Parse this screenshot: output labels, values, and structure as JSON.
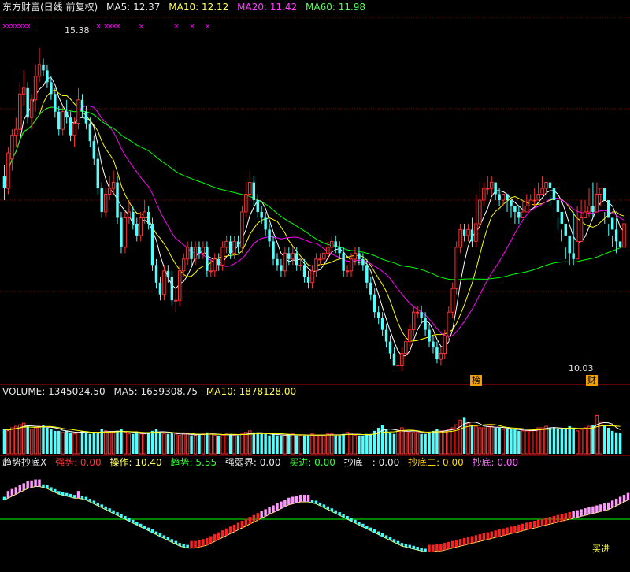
{
  "header": {
    "title": "东方财富(日线 前复权)",
    "ma5": "MA5: 12.37",
    "ma10": "MA10: 12.12",
    "ma20": "MA20: 11.42",
    "ma60": "MA60: 11.98"
  },
  "volume_header": {
    "label": "VOLUME: 1345024.50",
    "ma5": "MA5: 1659308.75",
    "ma10": "MA10: 1878128.00"
  },
  "indicator_header": {
    "title": "趋势抄底X",
    "strong": "强势: 0.00",
    "operate": "操作: 10.40",
    "trend": "趋势: 5.55",
    "boundary": "强弱界: 0.00",
    "buy": "买进: 0.00",
    "bottom1": "抄底一: 0.00",
    "bottom2": "抄底二: 0.00",
    "bottom": "抄底: 0.00"
  },
  "annotations": {
    "high": "15.38",
    "low": "10.03",
    "badge_1": "榜",
    "badge_2": "财",
    "buy_tag": "买进"
  },
  "colors": {
    "up": "#ff3232",
    "down": "#54ffff",
    "ma5": "#ffffff",
    "ma10": "#ffff00",
    "ma20": "#ff00ff",
    "ma60": "#00ff00",
    "grid": "#8b0000",
    "indicator_line": "#00ff00"
  },
  "chart_data": [
    {
      "type": "candlestick",
      "panel": "price",
      "ylim": [
        9.7,
        15.9
      ],
      "grid": true,
      "x": [
        1,
        2,
        3,
        4,
        5,
        6,
        7,
        8,
        9,
        10,
        11,
        12,
        13,
        14,
        15,
        16,
        17,
        18,
        19,
        20,
        21,
        22,
        23,
        24,
        25,
        26,
        27,
        28,
        29,
        30,
        31,
        32,
        33,
        34,
        35,
        36,
        37,
        38,
        39,
        40,
        41,
        42,
        43,
        44,
        45,
        46,
        47,
        48,
        49,
        50,
        51,
        52,
        53,
        54,
        55,
        56,
        57,
        58,
        59,
        60,
        61,
        62,
        63,
        64,
        65,
        66,
        67,
        68,
        69,
        70,
        71,
        72,
        73,
        74,
        75,
        76,
        77,
        78,
        79,
        80,
        81,
        82,
        83,
        84,
        85,
        86,
        87,
        88,
        89,
        90,
        91,
        92,
        93,
        94,
        95,
        96,
        97,
        98,
        99,
        100,
        101,
        102,
        103,
        104,
        105,
        106,
        107,
        108,
        109,
        110,
        111,
        112,
        113,
        114,
        115,
        116,
        117,
        118,
        119,
        120,
        121,
        122,
        123,
        124,
        125,
        126,
        127,
        128,
        129,
        130,
        131,
        132,
        133,
        134,
        135,
        136,
        137,
        138,
        139,
        140,
        141,
        142,
        143,
        144,
        145,
        146,
        147,
        148,
        149,
        150,
        151,
        152,
        153,
        154,
        155,
        156,
        157,
        158,
        159,
        160
      ],
      "open": [
        13.2,
        13.0,
        13.5,
        13.9,
        14.0,
        14.6,
        14.7,
        14.2,
        14.5,
        14.9,
        15.1,
        15.0,
        14.8,
        14.6,
        14.3,
        14.0,
        14.3,
        14.2,
        13.9,
        14.1,
        14.5,
        14.3,
        14.1,
        13.8,
        13.5,
        13.0,
        12.6,
        12.9,
        13.0,
        13.1,
        12.5,
        12.0,
        12.5,
        12.6,
        12.4,
        12.2,
        12.5,
        12.6,
        12.4,
        11.7,
        11.4,
        11.2,
        11.6,
        11.5,
        11.1,
        11.1,
        11.6,
        11.8,
        12.0,
        11.8,
        12.0,
        11.9,
        12.0,
        11.6,
        11.6,
        11.8,
        11.7,
        12.0,
        12.1,
        11.9,
        12.1,
        12.0,
        12.6,
        12.9,
        13.1,
        12.8,
        12.6,
        12.5,
        12.3,
        12.1,
        11.8,
        11.7,
        11.6,
        11.9,
        11.8,
        11.9,
        11.7,
        11.7,
        11.5,
        11.4,
        11.6,
        11.8,
        11.8,
        11.9,
        12.0,
        12.1,
        12.0,
        11.9,
        11.6,
        11.6,
        11.8,
        11.9,
        11.8,
        11.7,
        11.4,
        11.2,
        10.9,
        10.8,
        10.6,
        10.4,
        10.2,
        10.0,
        10.0,
        10.2,
        10.4,
        10.6,
        10.9,
        10.9,
        10.8,
        10.6,
        10.4,
        10.3,
        10.1,
        10.2,
        10.5,
        10.9,
        11.3,
        12.0,
        12.3,
        12.2,
        12.3,
        12.1,
        12.4,
        12.8,
        13.0,
        13.0,
        13.1,
        12.9,
        12.8,
        12.9,
        12.8,
        12.7,
        12.6,
        12.5,
        12.6,
        12.7,
        12.8,
        12.8,
        12.9,
        13.0,
        13.1,
        13.0,
        12.8,
        12.6,
        12.4,
        12.2,
        11.9,
        11.8,
        12.1,
        12.5,
        12.6,
        12.7,
        12.6,
        12.9,
        13.0,
        12.8,
        12.5,
        12.3,
        12.1,
        12.0
      ],
      "close": [
        13.0,
        13.6,
        13.9,
        14.0,
        14.6,
        14.7,
        14.2,
        14.5,
        14.9,
        15.1,
        15.0,
        14.8,
        14.6,
        14.3,
        14.0,
        14.3,
        14.2,
        13.9,
        14.1,
        14.5,
        14.3,
        14.1,
        13.8,
        13.5,
        13.0,
        12.6,
        12.9,
        13.0,
        13.1,
        12.5,
        12.0,
        12.5,
        12.6,
        12.4,
        12.2,
        12.5,
        12.6,
        12.4,
        11.7,
        11.4,
        11.2,
        11.6,
        11.5,
        11.1,
        11.1,
        11.6,
        11.8,
        12.0,
        11.8,
        12.0,
        11.9,
        12.0,
        11.6,
        11.6,
        11.8,
        11.7,
        12.0,
        12.1,
        11.9,
        12.1,
        12.0,
        12.6,
        12.9,
        13.1,
        12.8,
        12.6,
        12.5,
        12.3,
        12.1,
        11.8,
        11.7,
        11.6,
        11.9,
        11.8,
        11.9,
        11.7,
        11.7,
        11.5,
        11.4,
        11.6,
        11.8,
        11.8,
        11.9,
        12.0,
        12.1,
        12.0,
        11.9,
        11.6,
        11.6,
        11.8,
        11.9,
        11.8,
        11.7,
        11.4,
        11.2,
        10.9,
        10.8,
        10.6,
        10.4,
        10.2,
        10.0,
        10.0,
        10.2,
        10.4,
        10.6,
        10.9,
        10.9,
        10.8,
        10.6,
        10.4,
        10.3,
        10.1,
        10.2,
        10.5,
        10.9,
        11.3,
        12.0,
        12.3,
        12.2,
        12.3,
        12.1,
        12.4,
        12.8,
        13.0,
        13.0,
        13.1,
        12.9,
        12.8,
        12.9,
        12.8,
        12.7,
        12.6,
        12.5,
        12.6,
        12.7,
        12.8,
        12.8,
        12.9,
        13.0,
        13.1,
        13.0,
        12.8,
        12.6,
        12.4,
        12.2,
        11.9,
        11.8,
        12.1,
        12.5,
        12.6,
        12.7,
        12.6,
        12.9,
        13.0,
        12.8,
        12.5,
        12.3,
        12.1,
        12.0,
        12.4
      ],
      "high": [
        13.4,
        13.7,
        14.0,
        14.2,
        14.8,
        15.0,
        14.8,
        14.6,
        15.1,
        15.38,
        15.2,
        15.1,
        14.9,
        14.7,
        14.4,
        14.4,
        14.5,
        14.3,
        14.2,
        14.7,
        14.6,
        14.4,
        14.2,
        13.9,
        13.6,
        13.1,
        13.0,
        13.2,
        13.3,
        13.2,
        12.6,
        12.6,
        12.8,
        12.7,
        12.5,
        12.6,
        12.8,
        12.7,
        12.5,
        11.8,
        11.5,
        11.7,
        11.7,
        11.6,
        11.3,
        11.7,
        11.9,
        12.1,
        12.1,
        12.1,
        12.1,
        12.1,
        12.1,
        11.8,
        11.9,
        11.9,
        12.1,
        12.2,
        12.2,
        12.2,
        12.2,
        12.7,
        13.1,
        13.3,
        13.2,
        12.9,
        12.7,
        12.6,
        12.4,
        12.2,
        11.9,
        11.8,
        12.0,
        12.0,
        12.0,
        12.0,
        11.8,
        11.8,
        11.6,
        11.7,
        11.9,
        11.9,
        12.0,
        12.1,
        12.2,
        12.2,
        12.1,
        12.0,
        11.7,
        11.9,
        12.0,
        12.0,
        11.9,
        11.8,
        11.5,
        11.3,
        11.0,
        10.9,
        10.7,
        10.5,
        10.3,
        10.1,
        10.3,
        10.5,
        10.7,
        11.0,
        11.0,
        11.0,
        10.9,
        10.7,
        10.5,
        10.4,
        10.3,
        10.6,
        11.0,
        11.4,
        12.1,
        12.4,
        12.4,
        12.4,
        12.5,
        12.9,
        13.1,
        13.1,
        13.2,
        13.2,
        13.0,
        13.0,
        12.9,
        12.8,
        12.7,
        12.6,
        12.7,
        12.8,
        12.9,
        12.9,
        13.0,
        13.1,
        13.2,
        13.1,
        12.9,
        12.7,
        12.5,
        12.3,
        12.0,
        12.2,
        12.6,
        12.7,
        12.8,
        12.8,
        13.0,
        13.1,
        13.1,
        12.9,
        12.6,
        12.4,
        12.2,
        12.5
      ],
      "low": [
        12.8,
        12.9,
        13.3,
        13.7,
        13.9,
        14.4,
        14.1,
        14.0,
        14.3,
        14.8,
        14.9,
        14.7,
        14.5,
        14.2,
        13.9,
        13.9,
        14.1,
        13.8,
        13.7,
        14.0,
        14.2,
        14.0,
        13.7,
        13.4,
        12.9,
        12.5,
        12.5,
        12.8,
        12.9,
        12.4,
        11.9,
        11.9,
        12.4,
        12.3,
        12.1,
        12.1,
        12.4,
        12.3,
        11.6,
        11.3,
        11.1,
        11.1,
        11.4,
        11.0,
        10.9,
        11.0,
        11.5,
        11.7,
        11.7,
        11.7,
        11.8,
        11.8,
        11.5,
        11.5,
        11.5,
        11.6,
        11.6,
        11.9,
        11.8,
        11.8,
        11.9,
        11.9,
        12.5,
        12.8,
        12.7,
        12.5,
        12.4,
        12.2,
        12.0,
        11.7,
        11.6,
        11.5,
        11.5,
        11.7,
        11.7,
        11.6,
        11.6,
        11.4,
        11.3,
        11.3,
        11.5,
        11.7,
        11.7,
        11.8,
        11.9,
        11.9,
        11.8,
        11.5,
        11.5,
        11.5,
        11.7,
        11.7,
        11.6,
        11.3,
        11.1,
        10.8,
        10.7,
        10.5,
        10.3,
        10.1,
        10.03,
        10.03,
        9.9,
        10.1,
        10.3,
        10.5,
        10.8,
        10.7,
        10.5,
        10.3,
        10.2,
        10.03,
        10.0,
        10.1,
        10.4,
        10.8,
        11.2,
        11.9,
        12.1,
        12.1,
        12.0,
        12.0,
        12.3,
        12.7,
        12.9,
        12.9,
        12.8,
        12.7,
        12.7,
        12.6,
        12.5,
        12.4,
        12.4,
        12.5,
        12.6,
        12.7,
        12.7,
        12.8,
        12.9,
        12.9,
        12.7,
        12.5,
        12.3,
        12.1,
        11.8,
        11.7,
        11.7,
        12.0,
        12.4,
        12.5,
        12.5,
        12.5,
        12.8,
        12.7,
        12.4,
        12.2,
        12.0,
        11.9
      ],
      "series": [
        {
          "name": "MA5",
          "value": 12.37
        },
        {
          "name": "MA10",
          "value": 12.12
        },
        {
          "name": "MA20",
          "value": 11.42
        },
        {
          "name": "MA60",
          "value": 11.98
        }
      ]
    },
    {
      "type": "bar",
      "panel": "volume",
      "ylim": [
        0,
        3500000
      ],
      "values": [
        1.6,
        1.5,
        1.7,
        1.8,
        1.9,
        2.0,
        1.8,
        1.6,
        1.7,
        1.8,
        1.9,
        1.7,
        1.6,
        1.5,
        1.5,
        1.4,
        1.5,
        1.4,
        1.3,
        1.4,
        1.5,
        1.4,
        1.3,
        1.4,
        1.4,
        1.6,
        1.5,
        1.4,
        1.4,
        1.5,
        1.6,
        1.4,
        1.3,
        1.3,
        1.4,
        1.3,
        1.3,
        1.4,
        1.5,
        1.6,
        1.4,
        1.3,
        1.3,
        1.4,
        1.3,
        1.2,
        1.3,
        1.3,
        1.2,
        1.2,
        1.3,
        1.3,
        1.4,
        1.3,
        1.2,
        1.2,
        1.2,
        1.3,
        1.3,
        1.2,
        1.2,
        1.3,
        1.4,
        1.5,
        1.4,
        1.3,
        1.3,
        1.3,
        1.2,
        1.3,
        1.2,
        1.2,
        1.2,
        1.3,
        1.3,
        1.2,
        1.2,
        1.2,
        1.2,
        1.3,
        1.2,
        1.2,
        1.2,
        1.3,
        1.3,
        1.2,
        1.2,
        1.3,
        1.4,
        1.3,
        1.2,
        1.2,
        1.2,
        1.3,
        1.3,
        1.5,
        1.7,
        1.9,
        1.6,
        1.4,
        1.3,
        1.5,
        1.7,
        1.5,
        1.4,
        1.4,
        1.4,
        1.3,
        1.3,
        1.4,
        1.5,
        1.6,
        1.5,
        1.5,
        1.6,
        1.7,
        1.9,
        2.2,
        2.4,
        2.0,
        1.9,
        1.8,
        1.7,
        1.7,
        1.8,
        1.8,
        1.7,
        1.7,
        1.6,
        1.6,
        1.6,
        1.6,
        1.5,
        1.5,
        1.5,
        1.5,
        1.6,
        1.7,
        1.7,
        1.8,
        1.7,
        1.7,
        1.6,
        1.6,
        1.7,
        1.8,
        1.6,
        1.5,
        1.6,
        1.7,
        1.8,
        1.9,
        2.5,
        2.1,
        1.9,
        1.7,
        1.5,
        1.4,
        1.35
      ],
      "series": [
        {
          "name": "VOLUME",
          "value": 1345024.5
        },
        {
          "name": "MA5",
          "value": 1659308.75
        },
        {
          "name": "MA10",
          "value": 1878128.0
        }
      ]
    },
    {
      "type": "line",
      "panel": "indicator",
      "ylim": [
        0,
        100
      ],
      "boundary": 50,
      "operate": [
        70,
        72,
        74,
        76,
        78,
        80,
        82,
        83,
        84,
        84,
        83,
        82,
        80,
        78,
        76,
        75,
        74,
        73,
        72,
        72,
        71,
        70,
        68,
        66,
        64,
        62,
        60,
        58,
        56,
        54,
        52,
        50,
        48,
        46,
        44,
        42,
        40,
        38,
        36,
        34,
        32,
        30,
        28,
        26,
        24,
        22,
        21,
        20,
        20,
        20,
        21,
        22,
        23,
        25,
        27,
        29,
        31,
        33,
        35,
        37,
        39,
        41,
        43,
        45,
        47,
        49,
        51,
        53,
        55,
        57,
        59,
        61,
        63,
        65,
        66,
        67,
        68,
        68,
        68,
        67,
        66,
        64,
        62,
        60,
        58,
        56,
        54,
        52,
        50,
        48,
        46,
        44,
        42,
        40,
        38,
        36,
        34,
        32,
        30,
        28,
        26,
        24,
        22,
        21,
        20,
        19,
        18,
        17,
        16,
        16,
        16,
        17,
        17,
        18,
        19,
        20,
        21,
        22,
        23,
        24,
        25,
        26,
        27,
        28,
        29,
        30,
        31,
        32,
        33,
        34,
        35,
        36,
        37,
        38,
        39,
        40,
        41,
        42,
        43,
        44,
        45,
        46,
        47,
        48,
        49,
        50,
        51,
        52,
        53,
        54,
        55,
        56,
        57,
        58,
        59,
        60,
        62,
        64,
        66,
        68,
        70
      ]
    }
  ]
}
